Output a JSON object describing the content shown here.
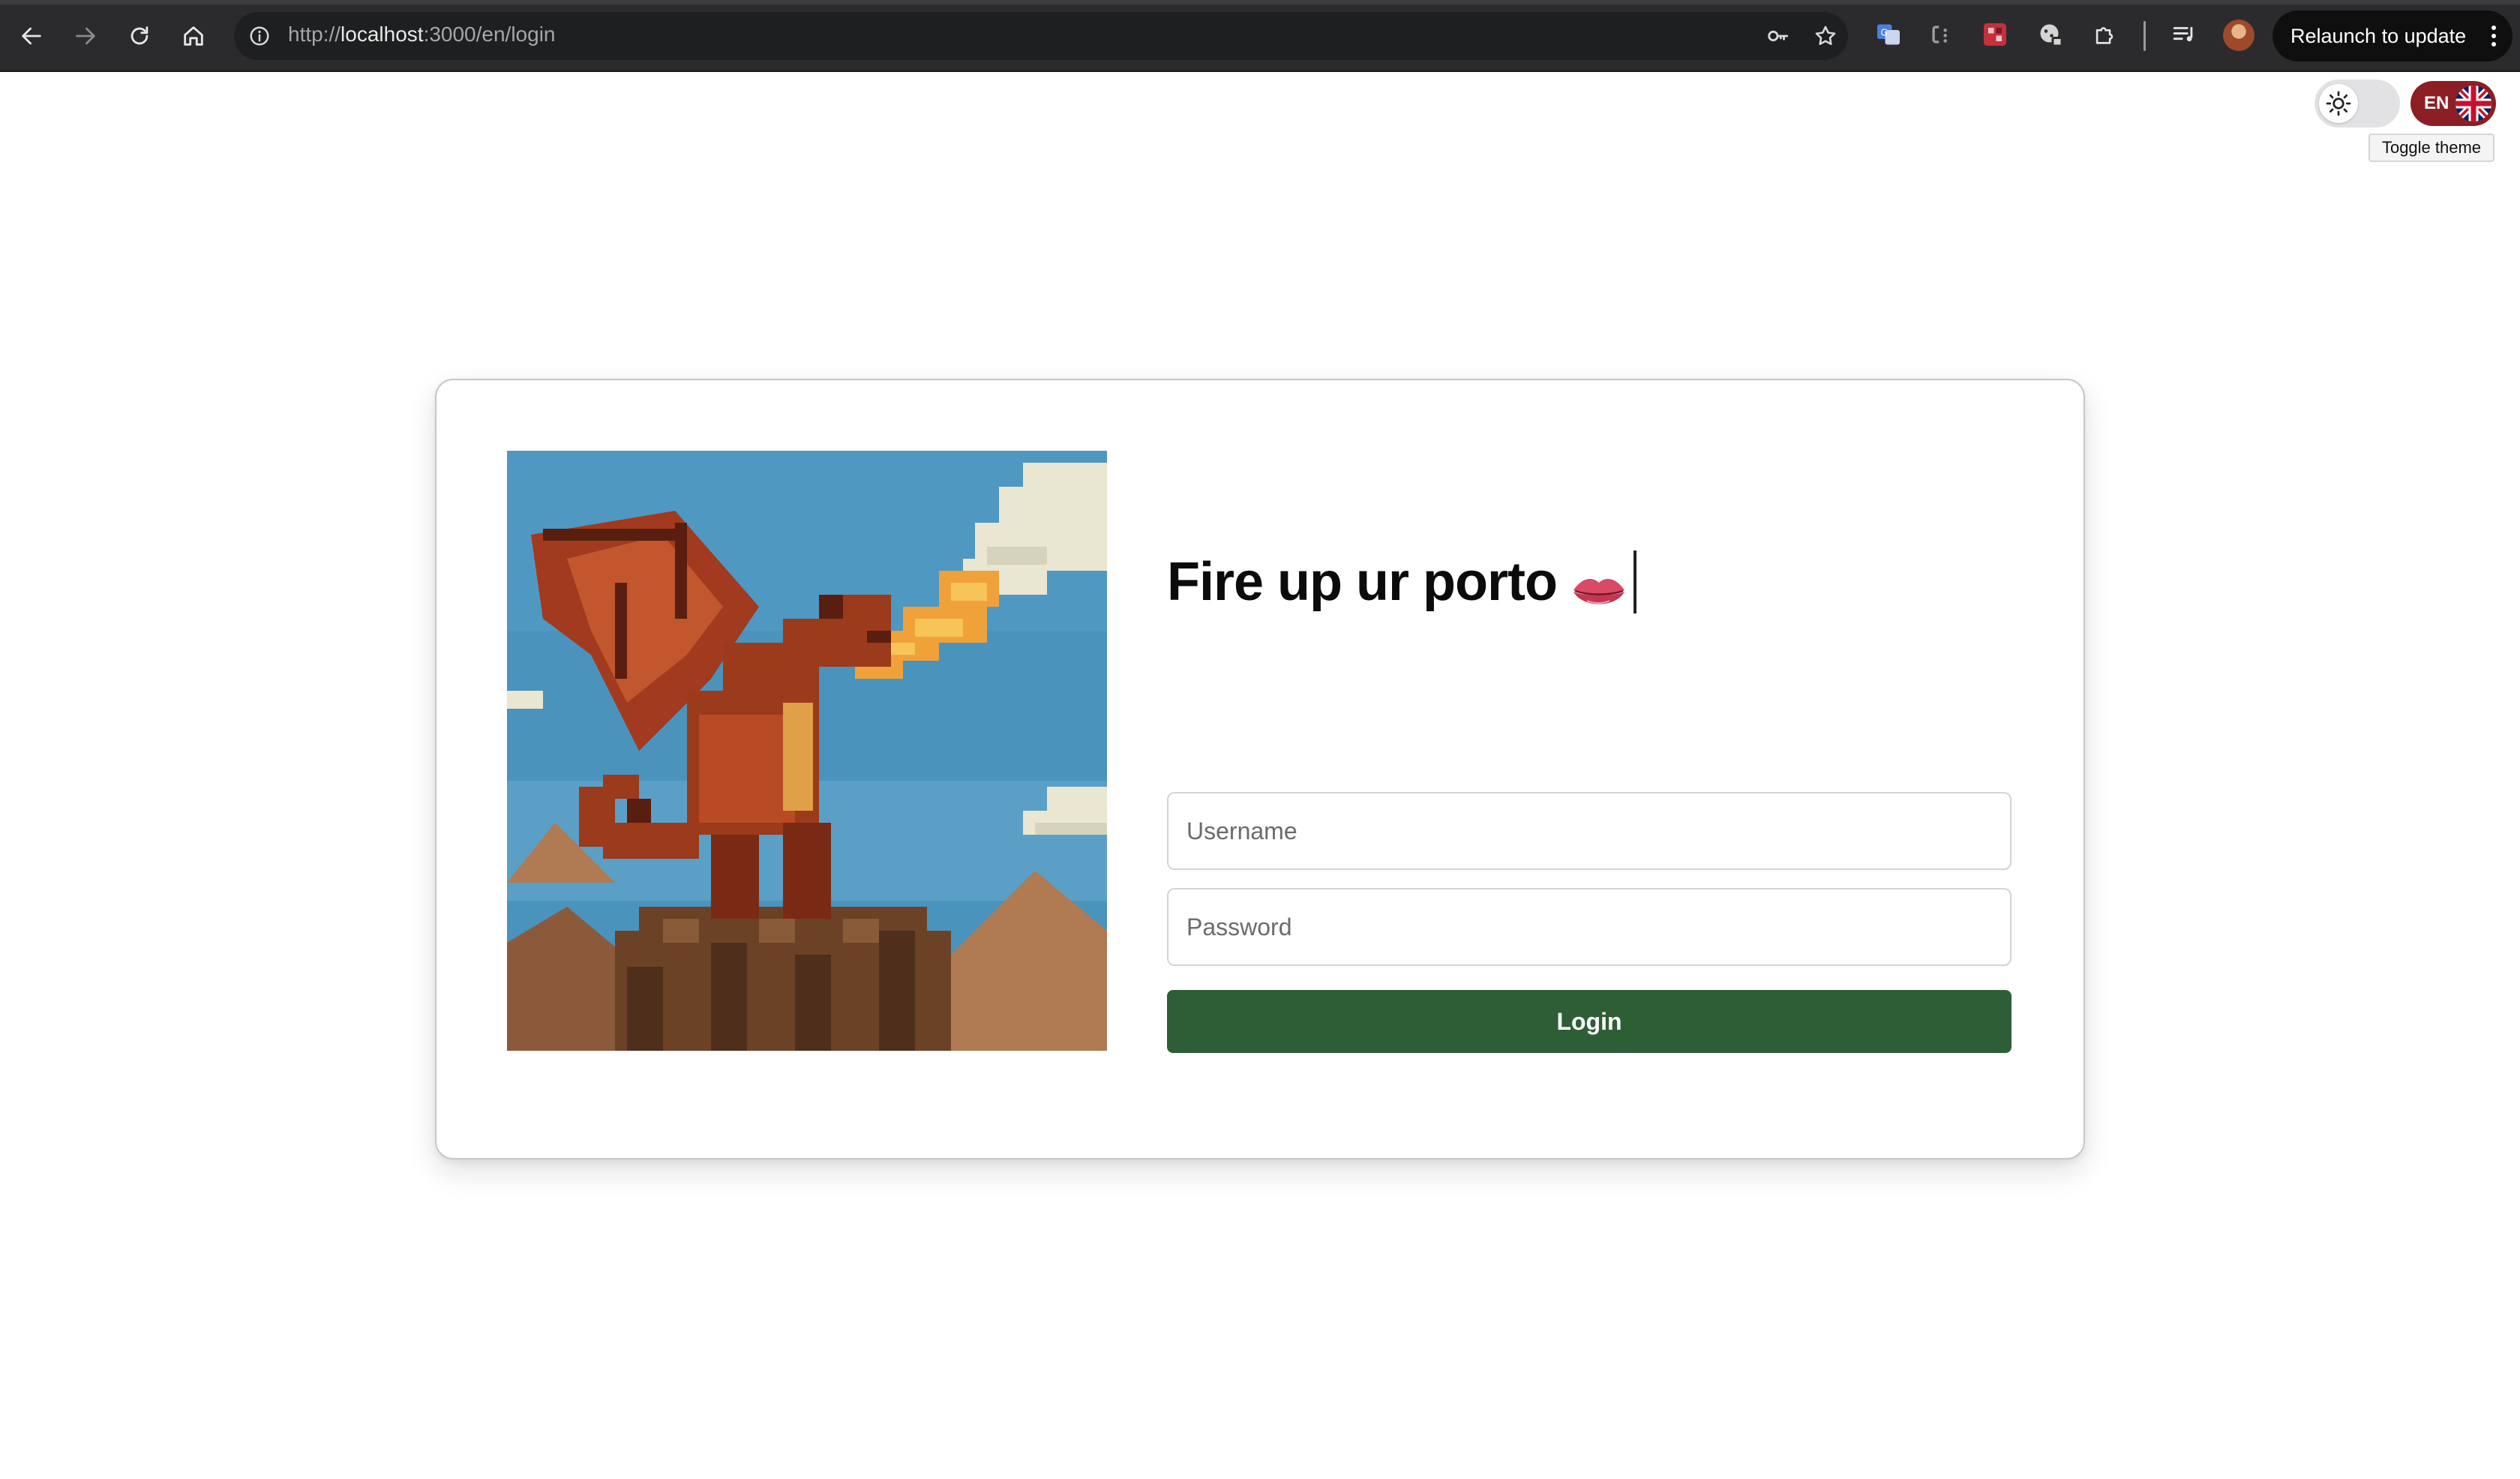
{
  "browser": {
    "url_scheme": "http://",
    "url_host": "localhost",
    "url_rest": ":3000/en/login",
    "relaunch_label": "Relaunch to update"
  },
  "header": {
    "language_code": "EN",
    "tooltip": "Toggle theme"
  },
  "login": {
    "title": "Fire up ur porto",
    "title_emoji": "lips-emoji",
    "username_placeholder": "Username",
    "password_placeholder": "Password",
    "login_label": "Login"
  },
  "colors": {
    "accent_green": "#2d5e35",
    "language_badge": "#8b1f24"
  }
}
